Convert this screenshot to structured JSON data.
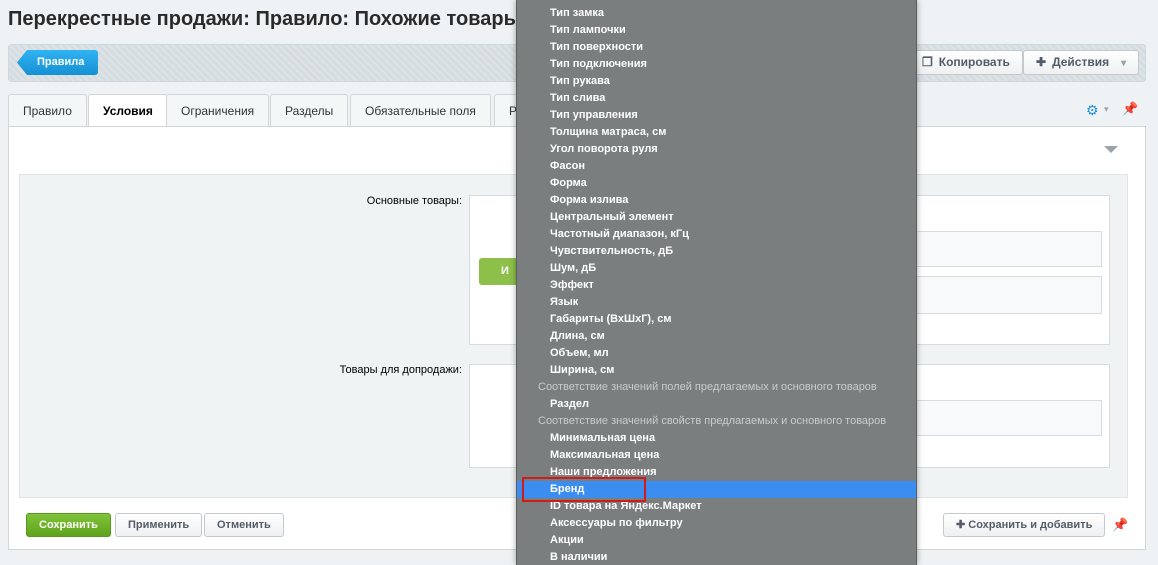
{
  "page": {
    "title": "Перекрестные продажи: Правило: Похожие товары те"
  },
  "toolbar": {
    "back_label": "Правила",
    "copy_label": "Копировать",
    "actions_label": "Действия"
  },
  "tabs": [
    {
      "label": "Правило"
    },
    {
      "label": "Условия"
    },
    {
      "label": "Ограничения"
    },
    {
      "label": "Разделы"
    },
    {
      "label": "Обязательные поля"
    },
    {
      "label": "Ре"
    }
  ],
  "form": {
    "main_goods_label": "Основные товары:",
    "upsell_goods_label": "Товары для допродажи:",
    "and_button_label": "И"
  },
  "footer": {
    "save_label": "Сохранить",
    "apply_label": "Применить",
    "cancel_label": "Отменить",
    "save_add_label": "Сохранить и добавить"
  },
  "dropdown": {
    "items": [
      {
        "type": "item",
        "label": "Тип замка"
      },
      {
        "type": "item",
        "label": "Тип лампочки"
      },
      {
        "type": "item",
        "label": "Тип поверхности"
      },
      {
        "type": "item",
        "label": "Тип подключения"
      },
      {
        "type": "item",
        "label": "Тип рукава"
      },
      {
        "type": "item",
        "label": "Тип слива"
      },
      {
        "type": "item",
        "label": "Тип управления"
      },
      {
        "type": "item",
        "label": "Толщина матраса, см"
      },
      {
        "type": "item",
        "label": "Угол поворота руля"
      },
      {
        "type": "item",
        "label": "Фасон"
      },
      {
        "type": "item",
        "label": "Форма"
      },
      {
        "type": "item",
        "label": "Форма излива"
      },
      {
        "type": "item",
        "label": "Центральный элемент"
      },
      {
        "type": "item",
        "label": "Частотный диапазон, кГц"
      },
      {
        "type": "item",
        "label": "Чувствительность, дБ"
      },
      {
        "type": "item",
        "label": "Шум, дБ"
      },
      {
        "type": "item",
        "label": "Эффект"
      },
      {
        "type": "item",
        "label": "Язык"
      },
      {
        "type": "item",
        "label": "Габариты (ВхШхГ), см"
      },
      {
        "type": "item",
        "label": "Длина, см"
      },
      {
        "type": "item",
        "label": "Объем, мл"
      },
      {
        "type": "item",
        "label": "Ширина, см"
      },
      {
        "type": "group",
        "label": "Соответствие значений полей предлагаемых и основного товаров"
      },
      {
        "type": "item",
        "label": "Раздел"
      },
      {
        "type": "group",
        "label": "Соответствие значений свойств предлагаемых и основного товаров"
      },
      {
        "type": "item",
        "label": "Минимальная цена"
      },
      {
        "type": "item",
        "label": "Максимальная цена"
      },
      {
        "type": "item",
        "label": "Наши предложения"
      },
      {
        "type": "item",
        "label": "Бренд",
        "selected": true
      },
      {
        "type": "item",
        "label": "ID товара на Яндекс.Маркет"
      },
      {
        "type": "item",
        "label": "Аксессуары по фильтру"
      },
      {
        "type": "item",
        "label": "Акции"
      },
      {
        "type": "item",
        "label": "В наличии"
      }
    ]
  },
  "colors": {
    "accent": "#1590d4",
    "selected_option": "#3b8ef0",
    "highlight_border": "#d11a1a",
    "save_green": "#5ea31c"
  },
  "icons": {
    "copy": "copy-icon",
    "plus": "plus-icon",
    "gear": "gear-icon",
    "pin": "pin-icon",
    "collapse": "triangle-down-icon"
  }
}
